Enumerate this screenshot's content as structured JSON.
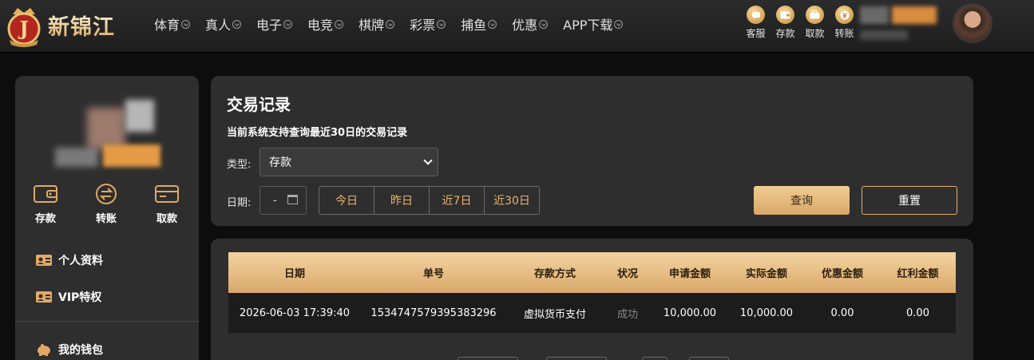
{
  "brand": {
    "logo_text": "新锦江"
  },
  "nav": {
    "items": [
      {
        "label": "体育"
      },
      {
        "label": "真人"
      },
      {
        "label": "电子"
      },
      {
        "label": "电竞"
      },
      {
        "label": "棋牌"
      },
      {
        "label": "彩票"
      },
      {
        "label": "捕鱼"
      },
      {
        "label": "优惠"
      },
      {
        "label": "APP下载"
      }
    ]
  },
  "quick_actions": [
    {
      "label": "客服",
      "icon": "chat-icon"
    },
    {
      "label": "存款",
      "icon": "wallet-icon"
    },
    {
      "label": "取款",
      "icon": "briefcase-icon"
    },
    {
      "label": "转账",
      "icon": "coin-icon"
    }
  ],
  "sidebar": {
    "wallet_actions": [
      {
        "label": "存款",
        "icon": "wallet-icon"
      },
      {
        "label": "转账",
        "icon": "transfer-icon"
      },
      {
        "label": "取款",
        "icon": "card-icon"
      }
    ],
    "links": [
      {
        "label": "个人资料",
        "icon": "id-card-icon"
      },
      {
        "label": "VIP特权",
        "icon": "vip-card-icon"
      },
      {
        "label": "我的钱包",
        "icon": "piggy-bank-icon"
      }
    ]
  },
  "transactions": {
    "title": "交易记录",
    "subtitle": "当前系统支持查询最近30日的交易记录",
    "type_label": "类型:",
    "type_value": "存款",
    "date_label": "日期:",
    "date_value": "-",
    "ranges": [
      "今日",
      "昨日",
      "近7日",
      "近30日"
    ],
    "query_label": "查询",
    "reset_label": "重置"
  },
  "table": {
    "headers": [
      "日期",
      "单号",
      "存款方式",
      "状况",
      "申请金额",
      "实际金额",
      "优惠金额",
      "红利金额"
    ],
    "rows": [
      [
        "2026-06-03 17:39:40",
        "1534747579395383296",
        "虚拟货币支付",
        "成功",
        "10,000.00",
        "10,000.00",
        "0.00",
        "0.00"
      ]
    ]
  },
  "colors": {
    "accent_gold": "#d9a86a",
    "panel_bg": "#2e2e2e",
    "page_bg": "#0d0d0d"
  }
}
